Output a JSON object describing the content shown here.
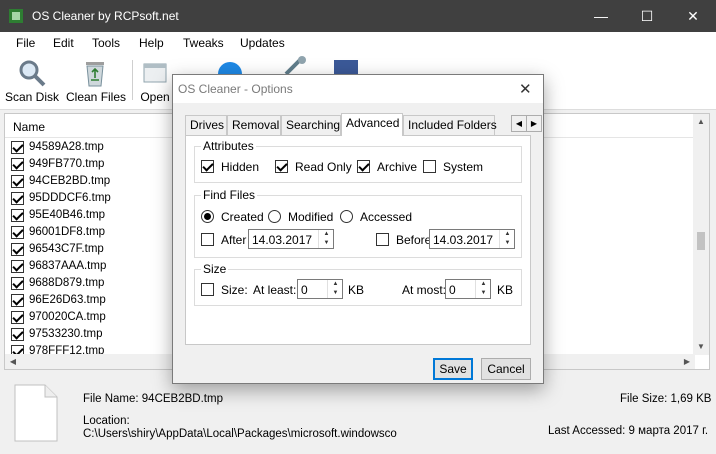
{
  "window": {
    "title": "OS Cleaner by RCPsoft.net",
    "minimize": "—",
    "maximize": "☐",
    "close": "✕"
  },
  "menu": [
    "File",
    "Edit",
    "Tools",
    "Help",
    "Tweaks",
    "Updates"
  ],
  "toolbar": {
    "scan_disk": "Scan Disk",
    "clean_files": "Clean Files",
    "open": "Open"
  },
  "list": {
    "column_name": "Name",
    "files": [
      "94589A28.tmp",
      "949FB770.tmp",
      "94CEB2BD.tmp",
      "95DDDCF6.tmp",
      "95E40B46.tmp",
      "96001DF8.tmp",
      "96543C7F.tmp",
      "96837AAA.tmp",
      "9688D879.tmp",
      "96E26D63.tmp",
      "970020CA.tmp",
      "97533230.tmp",
      "978FFF12.tmp"
    ]
  },
  "status": {
    "file_name": "File Name: 94CEB2BD.tmp",
    "file_size": "File Size: 1,69 KB",
    "location_label": "Location:",
    "location_path": "C:\\Users\\shiry\\AppData\\Local\\Packages\\microsoft.windowsco",
    "last_accessed": "Last Accessed: 9 марта 2017 г."
  },
  "dialog": {
    "title": "OS Cleaner - Options",
    "close": "✕",
    "tabs": [
      "Drives",
      "Removal",
      "Searching",
      "Advanced",
      "Included Folders"
    ],
    "active_tab": "Advanced",
    "attributes": {
      "label": "Attributes",
      "hidden": "Hidden",
      "read_only": "Read Only",
      "archive": "Archive",
      "system": "System",
      "checked": {
        "hidden": true,
        "read_only": true,
        "archive": true,
        "system": false
      }
    },
    "find_files": {
      "label": "Find Files",
      "created": "Created",
      "modified": "Modified",
      "accessed": "Accessed",
      "selected": "Created",
      "after_label": "After",
      "after_date": "14.03.2017",
      "before_label": "Before",
      "before_date": "14.03.2017"
    },
    "size": {
      "label": "Size",
      "size_label": "Size:",
      "at_least_label": "At least:",
      "at_least_value": "0",
      "at_least_unit": "KB",
      "at_most_label": "At most:",
      "at_most_value": "0",
      "at_most_unit": "KB"
    },
    "save": "Save",
    "cancel": "Cancel"
  }
}
